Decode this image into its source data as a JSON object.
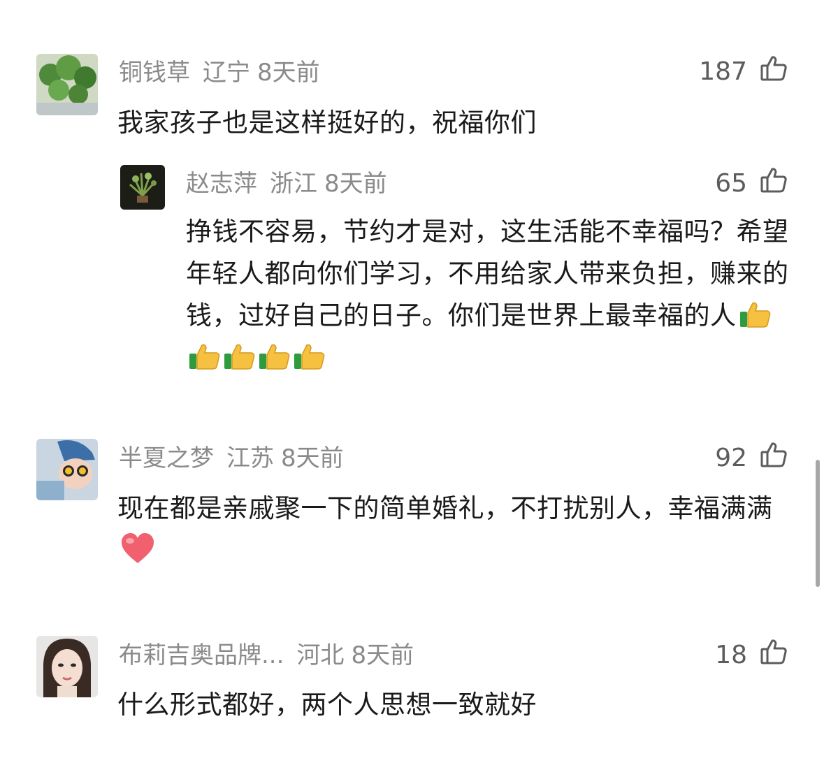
{
  "comments": [
    {
      "user": "铜钱草",
      "location": "辽宁",
      "time": "8天前",
      "likes": "187",
      "text": "我家孩子也是这样挺好的，祝福你们",
      "avatar": "plant-avatar"
    },
    {
      "user": "赵志萍",
      "location": "浙江",
      "time": "8天前",
      "likes": "65",
      "text": "挣钱不容易，节约才是对，这生活能不幸福吗？希望年轻人都向你们学习，不用给家人带来负担，赚来的钱，过好自己的日子。你们是世界上最幸福的人",
      "emoji": "thumbs-up",
      "emoji_count": 5,
      "avatar": "plant-avatar",
      "is_reply": true
    },
    {
      "user": "半夏之梦",
      "location": "江苏",
      "time": "8天前",
      "likes": "92",
      "text": "现在都是亲戚聚一下的简单婚礼，不打扰别人，幸福满满",
      "emoji": "heart",
      "avatar": "baby-avatar"
    },
    {
      "user": "布莉吉奥品牌...",
      "location": "河北",
      "time": "8天前",
      "likes": "18",
      "text": "什么形式都好，两个人思想一致就好",
      "avatar": "woman-avatar"
    }
  ],
  "icons": {
    "like": "thumbs-up-outline-icon"
  },
  "colors": {
    "meta": "#8a8a8a",
    "text": "#1a1a1a",
    "likes": "#5c5c5c"
  }
}
